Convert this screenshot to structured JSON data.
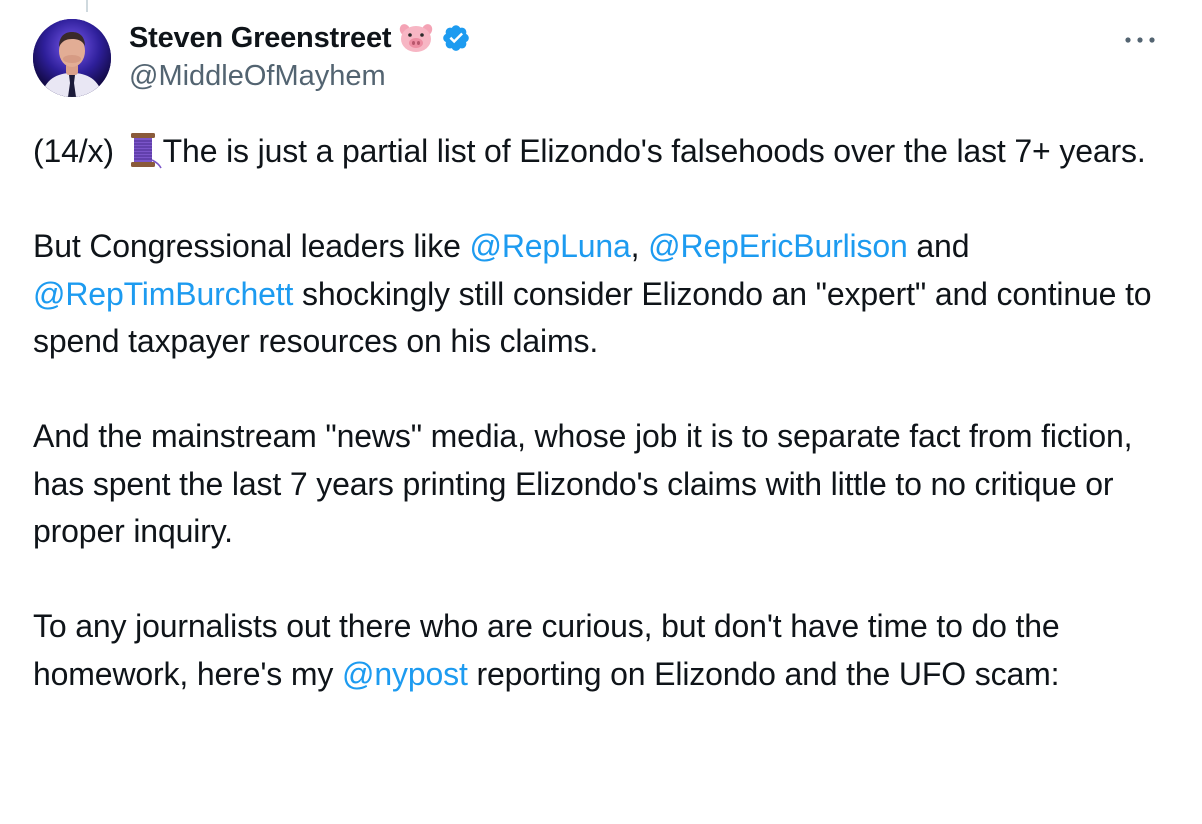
{
  "author": {
    "display_name": "Steven Greenstreet",
    "handle": "@MiddleOfMayhem",
    "name_emoji": "pig-face-icon",
    "verified": true,
    "verified_color": "#1d9bf0"
  },
  "menu": {
    "more_icon": "more-horizontal-icon"
  },
  "tweet": {
    "p1": {
      "counter": "(14/x)",
      "emoji": "thread-spool-icon",
      "text": "The is just a partial list of Elizondo's falsehoods over the last 7+ years."
    },
    "p2": {
      "t1": "But Congressional leaders like ",
      "m1": "@RepLuna",
      "t2": ", ",
      "m2": "@RepEricBurlison",
      "t3": " and ",
      "m3": "@RepTimBurchett",
      "t4": " shockingly still consider Elizondo an \"expert\" and continue to spend taxpayer resources on his claims."
    },
    "p3": {
      "text": "And the mainstream \"news\" media, whose job it is to separate fact from fiction, has spent the last 7 years printing Elizondo's claims with little to no critique or proper inquiry."
    },
    "p4": {
      "t1": "To any journalists out there who are curious, but don't have time to do the homework, here's my ",
      "m1": "@nypost",
      "t2": " reporting on Elizondo and the UFO scam:"
    }
  },
  "colors": {
    "text": "#0f1419",
    "secondary": "#536471",
    "link": "#1d9bf0"
  }
}
